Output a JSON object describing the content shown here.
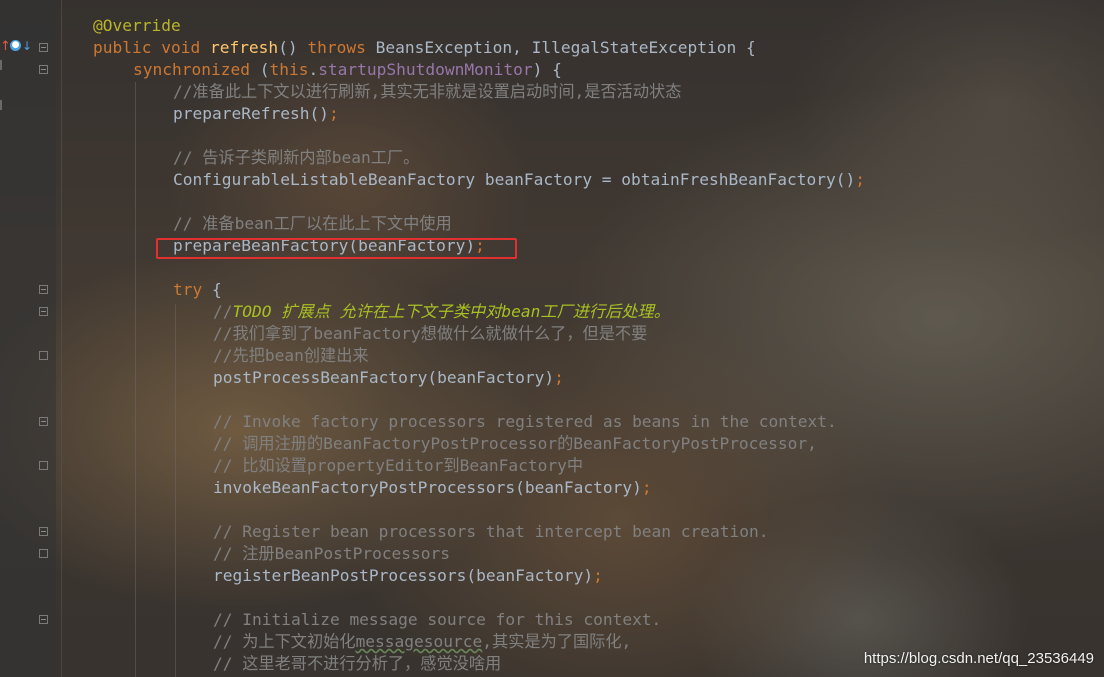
{
  "editor": {
    "lines": [
      {
        "id": "l1",
        "segments": [
          {
            "t": "@Override",
            "c": "ann"
          }
        ]
      },
      {
        "id": "l2",
        "segments": [
          {
            "t": "public void ",
            "c": "kw"
          },
          {
            "t": "refresh",
            "c": "fn"
          },
          {
            "t": "() ",
            "c": ""
          },
          {
            "t": "throws ",
            "c": "kw"
          },
          {
            "t": "BeansException, IllegalStateException {",
            "c": ""
          }
        ]
      },
      {
        "id": "l3",
        "segments": [
          {
            "t": "synchronized ",
            "c": "kw"
          },
          {
            "t": "(",
            "c": ""
          },
          {
            "t": "this",
            "c": "kw"
          },
          {
            "t": ".",
            "c": ""
          },
          {
            "t": "startupShutdownMonitor",
            "c": "field"
          },
          {
            "t": ") {",
            "c": ""
          }
        ]
      },
      {
        "id": "l4",
        "segments": [
          {
            "t": "//准备此上下文以进行刷新,其实无非就是设置启动时间,是否活动状态",
            "c": "cmt"
          }
        ]
      },
      {
        "id": "l5",
        "segments": [
          {
            "t": "prepareRefresh()",
            "c": ""
          },
          {
            "t": ";",
            "c": "kw"
          }
        ]
      },
      {
        "id": "l6",
        "segments": []
      },
      {
        "id": "l7",
        "segments": [
          {
            "t": "// 告诉子类刷新内部bean工厂。",
            "c": "cmt"
          }
        ]
      },
      {
        "id": "l8",
        "segments": [
          {
            "t": "ConfigurableListableBeanFactory beanFactory = obtainFreshBeanFactory()",
            "c": ""
          },
          {
            "t": ";",
            "c": "kw"
          }
        ]
      },
      {
        "id": "l9",
        "segments": []
      },
      {
        "id": "l10",
        "segments": [
          {
            "t": "// 准备bean工厂以在此上下文中使用",
            "c": "cmt"
          }
        ]
      },
      {
        "id": "l11",
        "segments": [
          {
            "t": "prepareBeanFactory(beanFactory)",
            "c": ""
          },
          {
            "t": ";",
            "c": "kw"
          }
        ]
      },
      {
        "id": "l12",
        "segments": []
      },
      {
        "id": "l13",
        "segments": [
          {
            "t": "try ",
            "c": "kw"
          },
          {
            "t": "{",
            "c": ""
          }
        ]
      },
      {
        "id": "l14",
        "segments": [
          {
            "t": "//",
            "c": "cmt"
          },
          {
            "t": "TODO 扩展点 允许在上下文子类中对bean工厂进行后处理。",
            "c": "todo"
          }
        ]
      },
      {
        "id": "l15",
        "segments": [
          {
            "t": "//我们拿到了beanFactory想做什么就做什么了，但是不要",
            "c": "cmt"
          }
        ]
      },
      {
        "id": "l16",
        "segments": [
          {
            "t": "//先把bean创建出来",
            "c": "cmt"
          }
        ]
      },
      {
        "id": "l17",
        "segments": [
          {
            "t": "postProcessBeanFactory(beanFactory)",
            "c": ""
          },
          {
            "t": ";",
            "c": "kw"
          }
        ]
      },
      {
        "id": "l18",
        "segments": []
      },
      {
        "id": "l19",
        "segments": [
          {
            "t": "// Invoke factory processors registered as beans in the context.",
            "c": "cmt"
          }
        ]
      },
      {
        "id": "l20",
        "segments": [
          {
            "t": "// 调用注册的BeanFactoryPostProcessor的BeanFactoryPostProcessor,",
            "c": "cmt"
          }
        ]
      },
      {
        "id": "l21",
        "segments": [
          {
            "t": "// 比如设置propertyEditor到BeanFactory中",
            "c": "cmt"
          }
        ]
      },
      {
        "id": "l22",
        "segments": [
          {
            "t": "invokeBeanFactoryPostProcessors(beanFactory)",
            "c": ""
          },
          {
            "t": ";",
            "c": "kw"
          }
        ]
      },
      {
        "id": "l23",
        "segments": []
      },
      {
        "id": "l24",
        "segments": [
          {
            "t": "// Register bean processors that intercept bean creation.",
            "c": "cmt"
          }
        ]
      },
      {
        "id": "l25",
        "segments": [
          {
            "t": "// 注册BeanPostProcessors",
            "c": "cmt"
          }
        ]
      },
      {
        "id": "l26",
        "segments": [
          {
            "t": "registerBeanPostProcessors(beanFactory)",
            "c": ""
          },
          {
            "t": ";",
            "c": "kw"
          }
        ]
      },
      {
        "id": "l27",
        "segments": []
      },
      {
        "id": "l28",
        "segments": [
          {
            "t": "// Initialize message source for this context.",
            "c": "cmt"
          }
        ]
      },
      {
        "id": "l29",
        "segments": [
          {
            "t": "// 为上下文初始化",
            "c": "cmt"
          },
          {
            "t": "messagesource",
            "c": "cmt squiggle"
          },
          {
            "t": ",其实是为了国际化,",
            "c": "cmt"
          }
        ]
      },
      {
        "id": "l30",
        "segments": [
          {
            "t": "// 这里老哥不进行分析了，感觉没啥用",
            "c": "cmt"
          }
        ]
      }
    ]
  },
  "watermark": "https://blog.csdn.net/qq_23536449",
  "colors": {
    "keyword": "#cc7832",
    "annotation": "#bbb529",
    "method": "#ffc66d",
    "field": "#9876aa",
    "comment": "#808080",
    "todo": "#a8c023",
    "default": "#a9b7c6",
    "highlight_box": "#e23030"
  },
  "icons": [
    "override-up-arrow-icon",
    "implementation-marker-icon",
    "fold-marker-icon"
  ]
}
